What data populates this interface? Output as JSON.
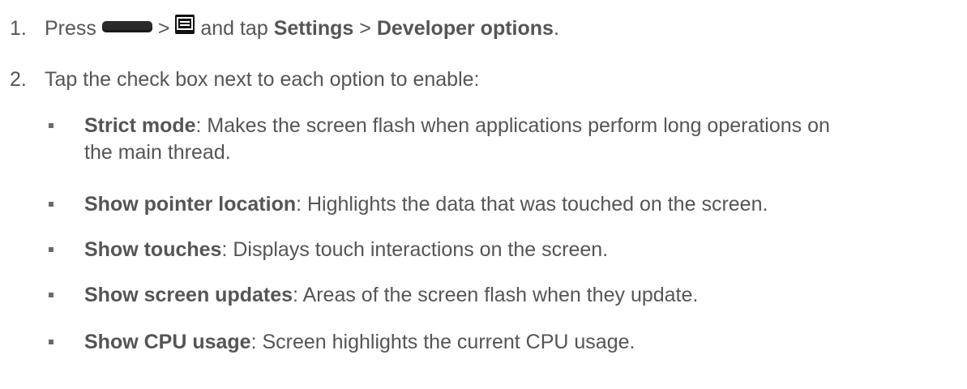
{
  "step1": {
    "number": "1.",
    "press": "Press",
    "sep1": ">",
    "and_tap": "and tap",
    "settings": "Settings",
    "sep2": ">",
    "developer": "Developer options",
    "end": ".",
    "icons": [
      "home-key-icon",
      "menu-key-icon"
    ]
  },
  "step2": {
    "number": "2.",
    "text": "Tap the check box next to each option to enable:"
  },
  "options": [
    {
      "term": "Strict mode",
      "desc": ": Makes the screen flash when applications perform long operations on",
      "desc2": "the main thread."
    },
    {
      "term": "Show pointer location",
      "desc": ": Highlights the data that was touched on the screen."
    },
    {
      "term": "Show touches",
      "desc": ": Displays touch interactions on the screen."
    },
    {
      "term": "Show screen updates",
      "desc": ": Areas of the screen flash when they update."
    },
    {
      "term": "Show CPU usage",
      "desc": ": Screen highlights the current CPU usage."
    }
  ]
}
